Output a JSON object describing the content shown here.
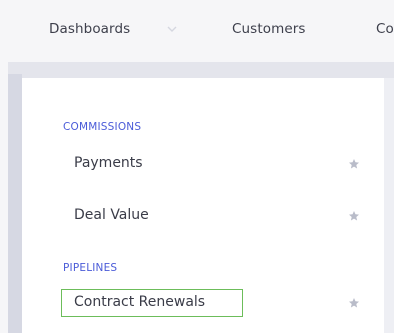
{
  "topnav": {
    "dashboards_label": "Dashboards",
    "customers_label": "Customers",
    "clipped_label": "Co"
  },
  "menu": {
    "sections": [
      {
        "label": "COMMISSIONS",
        "items": [
          {
            "label": "Payments",
            "icon": "star-icon"
          },
          {
            "label": "Deal Value",
            "icon": "star-icon"
          }
        ]
      },
      {
        "label": "PIPELINES",
        "items": [
          {
            "label": "Contract Renewals",
            "icon": "star-icon",
            "highlighted": true
          }
        ]
      }
    ]
  },
  "colors": {
    "section_label": "#4a5bd8",
    "highlight_border": "#6cbd5a",
    "star": "#b9bcc9"
  }
}
